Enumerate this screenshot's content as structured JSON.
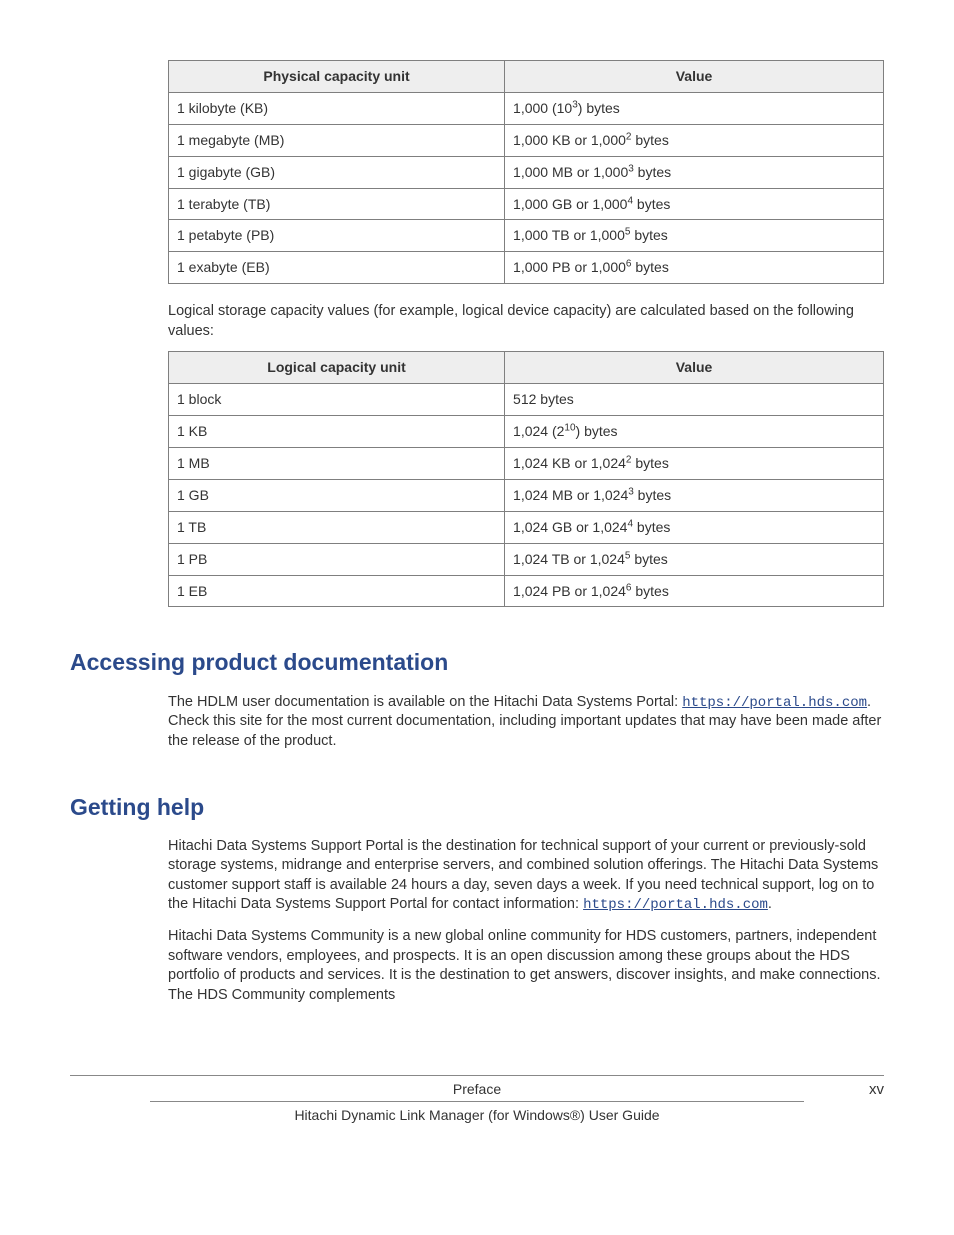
{
  "table1": {
    "headers": [
      "Physical capacity unit",
      "Value"
    ],
    "rows": [
      {
        "unit": "1 kilobyte (KB)",
        "prefix": "1,000 (10",
        "sup": "3",
        "suffix": ") bytes"
      },
      {
        "unit": "1 megabyte (MB)",
        "prefix": "1,000 KB or 1,000",
        "sup": "2",
        "suffix": " bytes"
      },
      {
        "unit": "1 gigabyte (GB)",
        "prefix": "1,000 MB or 1,000",
        "sup": "3",
        "suffix": " bytes"
      },
      {
        "unit": "1 terabyte (TB)",
        "prefix": "1,000 GB or 1,000",
        "sup": "4",
        "suffix": " bytes"
      },
      {
        "unit": "1 petabyte (PB)",
        "prefix": "1,000 TB or 1,000",
        "sup": "5",
        "suffix": " bytes"
      },
      {
        "unit": "1 exabyte (EB)",
        "prefix": "1,000 PB or 1,000",
        "sup": "6",
        "suffix": " bytes"
      }
    ]
  },
  "intertext": "Logical storage capacity values (for example, logical device capacity) are calculated based on the following values:",
  "table2": {
    "headers": [
      "Logical capacity unit",
      "Value"
    ],
    "rows": [
      {
        "unit": "1 block",
        "prefix": "512 bytes",
        "sup": "",
        "suffix": ""
      },
      {
        "unit": "1 KB",
        "prefix": "1,024 (2",
        "sup": "10",
        "suffix": ") bytes"
      },
      {
        "unit": "1 MB",
        "prefix": "1,024 KB or 1,024",
        "sup": "2",
        "suffix": " bytes"
      },
      {
        "unit": "1 GB",
        "prefix": "1,024 MB or 1,024",
        "sup": "3",
        "suffix": " bytes"
      },
      {
        "unit": "1 TB",
        "prefix": "1,024 GB or 1,024",
        "sup": "4",
        "suffix": " bytes"
      },
      {
        "unit": "1 PB",
        "prefix": "1,024 TB or 1,024",
        "sup": "5",
        "suffix": " bytes"
      },
      {
        "unit": "1 EB",
        "prefix": "1,024 PB or 1,024",
        "sup": "6",
        "suffix": " bytes"
      }
    ]
  },
  "section1": {
    "heading": "Accessing product documentation",
    "para_pre": "The HDLM user documentation is available on the Hitachi Data Systems Portal: ",
    "link": "https://portal.hds.com",
    "para_post": ". Check this site for the most current documentation, including important updates that may have been made after the release of the product."
  },
  "section2": {
    "heading": "Getting help",
    "para1_pre": "Hitachi Data Systems Support Portal is the destination for technical support of your current or previously-sold storage systems, midrange and enterprise servers, and combined solution offerings. The Hitachi Data Systems customer support staff is available 24 hours a day, seven days a week. If you need technical support, log on to the Hitachi Data Systems Support Portal for contact information: ",
    "link": "https://portal.hds.com",
    "para1_post": ".",
    "para2": "Hitachi Data Systems Community is a new global online community for HDS customers, partners, independent software vendors, employees, and prospects. It is an open discussion among these groups about the HDS portfolio of products and services. It is the destination to get answers, discover insights, and make connections. The HDS Community complements"
  },
  "footer": {
    "top": "Preface",
    "bottom": "Hitachi Dynamic Link Manager (for Windows®) User Guide",
    "page": "xv"
  }
}
